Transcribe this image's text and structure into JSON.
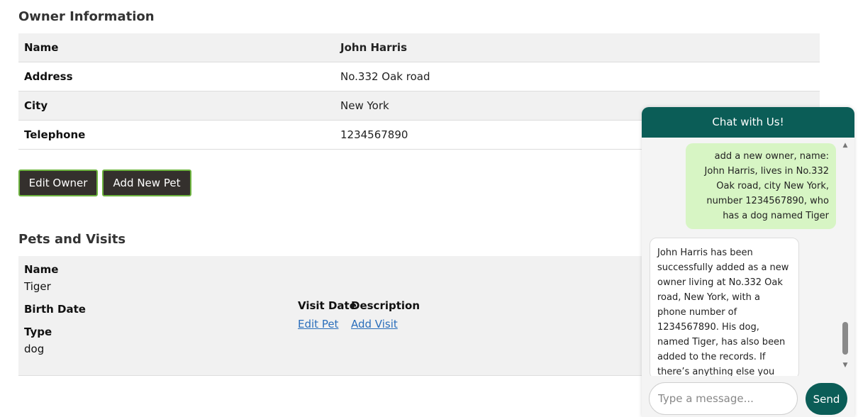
{
  "owner_section": {
    "title": "Owner Information",
    "rows": [
      {
        "label": "Name",
        "value": "John Harris"
      },
      {
        "label": "Address",
        "value": "No.332 Oak road"
      },
      {
        "label": "City",
        "value": "New York"
      },
      {
        "label": "Telephone",
        "value": "1234567890"
      }
    ],
    "edit_button": "Edit Owner",
    "add_pet_button": "Add New Pet"
  },
  "pets_section": {
    "title": "Pets and Visits",
    "pet": {
      "name_label": "Name",
      "name": "Tiger",
      "birth_label": "Birth Date",
      "type_label": "Type",
      "type": "dog"
    },
    "visit_headers": {
      "date": "Visit Date",
      "description": "Description"
    },
    "links": {
      "edit_pet": "Edit Pet",
      "add_visit": "Add Visit"
    }
  },
  "chat": {
    "header": "Chat with Us!",
    "messages": [
      {
        "from": "user",
        "text": "add a new owner, name: John Harris, lives in No.332 Oak road, city New York, number 1234567890, who has a dog named Tiger"
      },
      {
        "from": "bot",
        "text": "John Harris has been successfully added as a new owner living at No.332 Oak road, New York, with a phone number of 1234567890. His dog, named Tiger, has also been added to the records. If there’s anything else you"
      }
    ],
    "input_placeholder": "Type a message...",
    "send_label": "Send",
    "colors": {
      "header": "#0b5d57",
      "user_bubble": "#d7f5c4"
    }
  },
  "colors": {
    "button_bg": "#34302d",
    "button_border": "#6db33f",
    "link": "#2a6ebb"
  }
}
